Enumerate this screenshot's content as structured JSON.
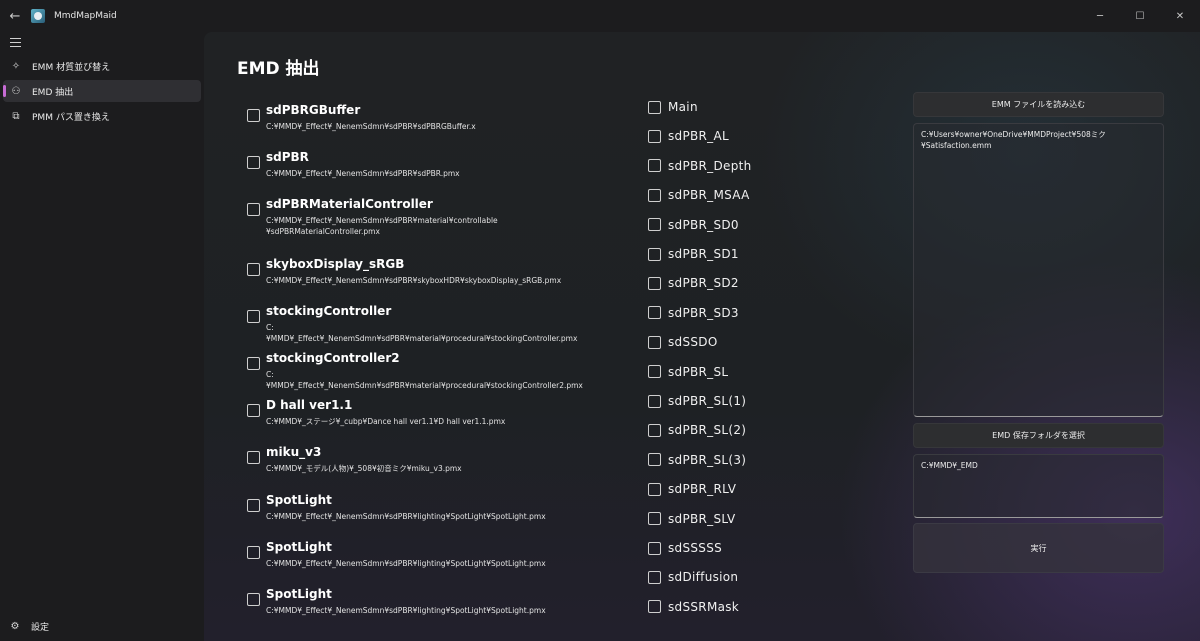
{
  "titlebar": {
    "app_title": "MmdMapMaid",
    "back_glyph": "←",
    "minimize_glyph": "─",
    "maximize_glyph": "☐",
    "close_glyph": "✕"
  },
  "sidebar": {
    "items": [
      {
        "label": "EMM 材質並び替え",
        "icon": "sparkle-icon",
        "glyph": "✧"
      },
      {
        "label": "EMD 抽出",
        "icon": "group-icon",
        "glyph": "⚇"
      },
      {
        "label": "PMM パス置き換え",
        "icon": "copy-icon",
        "glyph": "⧉"
      }
    ],
    "active_index": 1,
    "settings_label": "設定",
    "settings_glyph": "⚙",
    "accent_color": "#c66bd4"
  },
  "page": {
    "title": "EMD 抽出"
  },
  "effects": [
    {
      "name": "sdPBRGBuffer",
      "path": "C:¥MMD¥_Effect¥_NenemSdmn¥sdPBR¥sdPBRGBuffer.x"
    },
    {
      "name": "sdPBR",
      "path": "C:¥MMD¥_Effect¥_NenemSdmn¥sdPBR¥sdPBR.pmx"
    },
    {
      "name": "sdPBRMaterialController",
      "path": "C:¥MMD¥_Effect¥_NenemSdmn¥sdPBR¥material¥controllable\n¥sdPBRMaterialController.pmx"
    },
    {
      "name": "skyboxDisplay_sRGB",
      "path": "C:¥MMD¥_Effect¥_NenemSdmn¥sdPBR¥skyboxHDR¥skyboxDisplay_sRGB.pmx"
    },
    {
      "name": "stockingController",
      "path": "C:¥MMD¥_Effect¥_NenemSdmn¥sdPBR¥material¥procedural¥stockingController.pmx"
    },
    {
      "name": "stockingController2",
      "path": "C:¥MMD¥_Effect¥_NenemSdmn¥sdPBR¥material¥procedural¥stockingController2.pmx"
    },
    {
      "name": "D hall ver1.1",
      "path": "C:¥MMD¥_ステージ¥_cubp¥Dance hall ver1.1¥D hall ver1.1.pmx"
    },
    {
      "name": "miku_v3",
      "path": "C:¥MMD¥_モデル(人物)¥_508¥初音ミク¥miku_v3.pmx"
    },
    {
      "name": "SpotLight",
      "path": "C:¥MMD¥_Effect¥_NenemSdmn¥sdPBR¥lighting¥SpotLight¥SpotLight.pmx"
    },
    {
      "name": "SpotLight",
      "path": "C:¥MMD¥_Effect¥_NenemSdmn¥sdPBR¥lighting¥SpotLight¥SpotLight.pmx"
    },
    {
      "name": "SpotLight",
      "path": "C:¥MMD¥_Effect¥_NenemSdmn¥sdPBR¥lighting¥SpotLight¥SpotLight.pmx"
    }
  ],
  "targets": [
    "Main",
    "sdPBR_AL",
    "sdPBR_Depth",
    "sdPBR_MSAA",
    "sdPBR_SD0",
    "sdPBR_SD1",
    "sdPBR_SD2",
    "sdPBR_SD3",
    "sdSSDO",
    "sdPBR_SL",
    "sdPBR_SL(1)",
    "sdPBR_SL(2)",
    "sdPBR_SL(3)",
    "sdPBR_RLV",
    "sdPBR_SLV",
    "sdSSSSS",
    "sdDiffusion",
    "sdSSRMask"
  ],
  "actions": {
    "load_emm_label": "EMM ファイルを読み込む",
    "emm_path": "C:¥Users¥owner¥OneDrive¥MMDProject¥508ミク\n¥Satisfaction.emm",
    "select_folder_label": "EMD 保存フォルダを選択",
    "folder_path": "C:¥MMD¥_EMD",
    "run_label": "実行"
  }
}
